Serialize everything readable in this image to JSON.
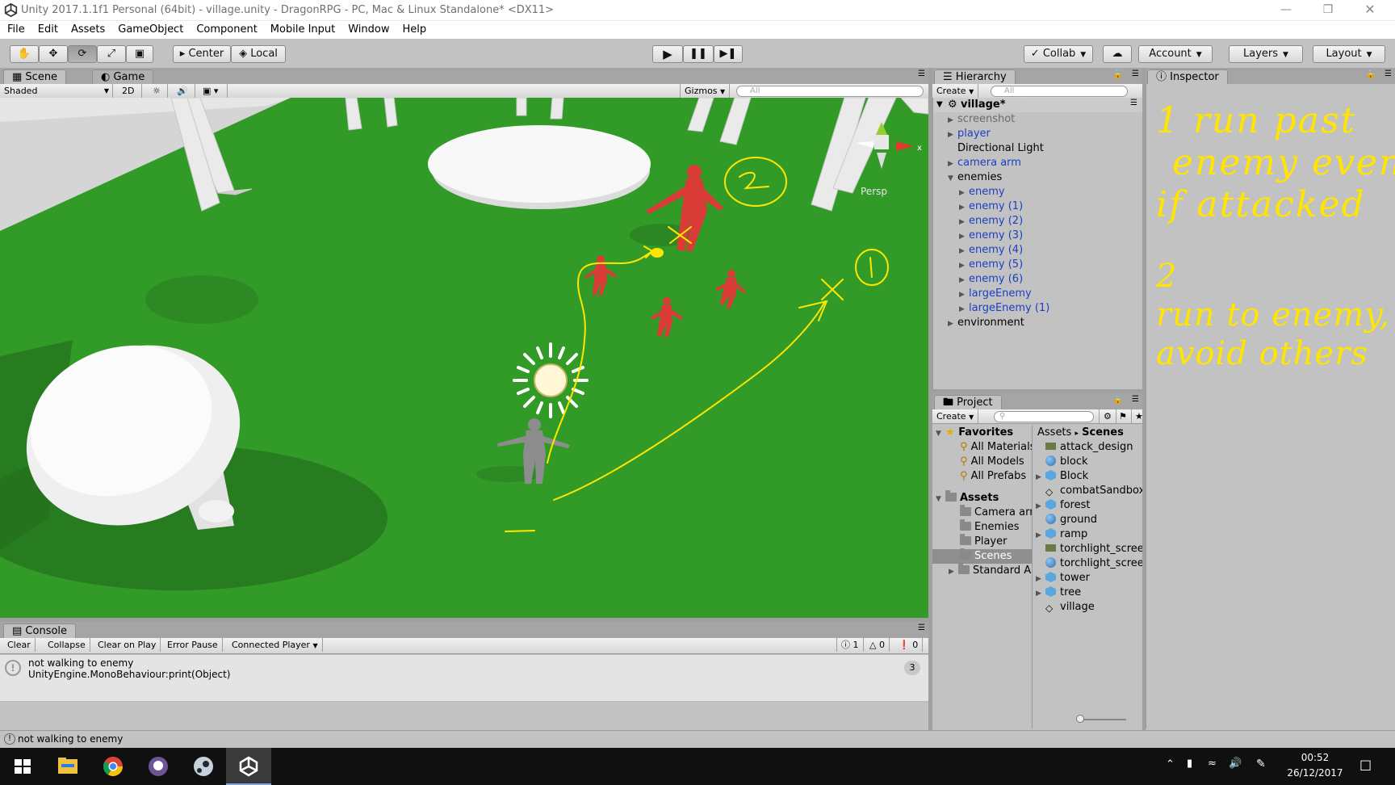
{
  "window": {
    "title": "Unity 2017.1.1f1 Personal (64bit) - village.unity - DragonRPG - PC, Mac & Linux Standalone* <DX11>"
  },
  "menu": [
    "File",
    "Edit",
    "Assets",
    "GameObject",
    "Component",
    "Mobile Input",
    "Window",
    "Help"
  ],
  "toolbar": {
    "pivot": "Center",
    "space": "Local",
    "collab": "Collab",
    "account": "Account",
    "layers": "Layers",
    "layout": "Layout"
  },
  "scene_panel": {
    "tabs": [
      "Scene",
      "Game"
    ],
    "shading": "Shaded",
    "mode_2d": "2D",
    "gizmos": "Gizmos",
    "search_placeholder": "All",
    "persp_label": "Persp"
  },
  "hierarchy": {
    "tab": "Hierarchy",
    "create": "Create",
    "search_placeholder": "All",
    "scene": "village*",
    "items": [
      {
        "label": "screenshot",
        "color": "gray",
        "depth": 1,
        "arrow": "right"
      },
      {
        "label": "player",
        "color": "blue",
        "depth": 1,
        "arrow": "right"
      },
      {
        "label": "Directional Light",
        "color": "black",
        "depth": 1,
        "arrow": ""
      },
      {
        "label": "camera arm",
        "color": "blue",
        "depth": 1,
        "arrow": "right"
      },
      {
        "label": "enemies",
        "color": "black",
        "depth": 1,
        "arrow": "down"
      },
      {
        "label": "enemy",
        "color": "blue",
        "depth": 2,
        "arrow": "right"
      },
      {
        "label": "enemy (1)",
        "color": "blue",
        "depth": 2,
        "arrow": "right"
      },
      {
        "label": "enemy (2)",
        "color": "blue",
        "depth": 2,
        "arrow": "right"
      },
      {
        "label": "enemy (3)",
        "color": "blue",
        "depth": 2,
        "arrow": "right"
      },
      {
        "label": "enemy (4)",
        "color": "blue",
        "depth": 2,
        "arrow": "right"
      },
      {
        "label": "enemy (5)",
        "color": "blue",
        "depth": 2,
        "arrow": "right"
      },
      {
        "label": "enemy (6)",
        "color": "blue",
        "depth": 2,
        "arrow": "right"
      },
      {
        "label": "largeEnemy",
        "color": "blue",
        "depth": 2,
        "arrow": "right"
      },
      {
        "label": "largeEnemy (1)",
        "color": "blue",
        "depth": 2,
        "arrow": "right"
      },
      {
        "label": "environment",
        "color": "black",
        "depth": 1,
        "arrow": "right"
      }
    ]
  },
  "inspector": {
    "tab": "Inspector",
    "note1": [
      "1 run past",
      "enemy even",
      "if attacked"
    ],
    "note2": [
      "2",
      "run to enemy,",
      "avoid others"
    ]
  },
  "project": {
    "tab": "Project",
    "create": "Create",
    "breadcrumb_root": "Assets",
    "breadcrumb_leaf": "Scenes",
    "favorites_label": "Favorites",
    "favorites": [
      "All Materials",
      "All Models",
      "All Prefabs"
    ],
    "assets_label": "Assets",
    "folders": [
      "Camera arm",
      "Enemies",
      "Player",
      "Scenes",
      "Standard Assets"
    ],
    "files": [
      {
        "label": "attack_design",
        "icon": "image",
        "arrow": false
      },
      {
        "label": "block",
        "icon": "sphere",
        "arrow": false
      },
      {
        "label": "Block",
        "icon": "cube",
        "arrow": true
      },
      {
        "label": "combatSandbox",
        "icon": "unity",
        "arrow": false
      },
      {
        "label": "forest",
        "icon": "cube",
        "arrow": true
      },
      {
        "label": "ground",
        "icon": "sphere",
        "arrow": false
      },
      {
        "label": "ramp",
        "icon": "cube",
        "arrow": true
      },
      {
        "label": "torchlight_screen",
        "icon": "image",
        "arrow": false
      },
      {
        "label": "torchlight_screen",
        "icon": "sphere",
        "arrow": false
      },
      {
        "label": "tower",
        "icon": "cube",
        "arrow": true
      },
      {
        "label": "tree",
        "icon": "cube",
        "arrow": true
      },
      {
        "label": "village",
        "icon": "unity",
        "arrow": false
      }
    ]
  },
  "console": {
    "tab": "Console",
    "buttons": [
      "Clear",
      "Collapse",
      "Clear on Play",
      "Error Pause",
      "Connected Player"
    ],
    "counts": {
      "log": "1",
      "warn": "0",
      "error": "0"
    },
    "message_line1": "not walking to enemy",
    "message_line2": "UnityEngine.MonoBehaviour:print(Object)",
    "message_count": "3"
  },
  "status_bar": {
    "message": "not walking to enemy"
  },
  "taskbar": {
    "time": "00:52",
    "date": "26/12/2017"
  },
  "annotation_color": "#ffe500"
}
